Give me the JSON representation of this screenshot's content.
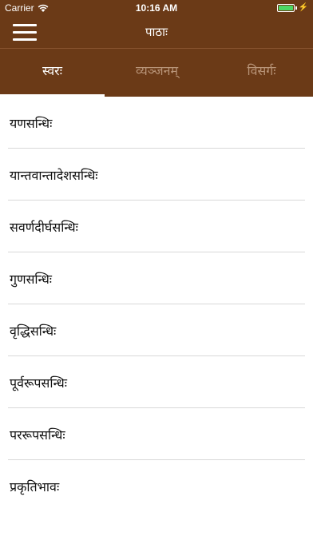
{
  "status_bar": {
    "carrier": "Carrier",
    "time": "10:16 AM",
    "battery_icon": "battery-full-icon",
    "wifi_icon": "wifi-icon",
    "charging_icon": "charging-bolt-icon"
  },
  "nav": {
    "title": "पाठाः",
    "menu_icon": "hamburger-menu-icon"
  },
  "tabs": [
    {
      "label": "स्वरः",
      "active": true
    },
    {
      "label": "व्यञ्जनम्",
      "active": false
    },
    {
      "label": "विसर्गः",
      "active": false
    }
  ],
  "list": {
    "items": [
      {
        "label": "यणसन्धिः"
      },
      {
        "label": "यान्तवान्तादेशसन्धिः"
      },
      {
        "label": "सवर्णदीर्घसन्धिः"
      },
      {
        "label": "गुणसन्धिः"
      },
      {
        "label": "वृद्धिसन्धिः"
      },
      {
        "label": "पूर्वरूपसन्धिः"
      },
      {
        "label": "पररूपसन्धिः"
      },
      {
        "label": "प्रकृतिभावः"
      }
    ]
  },
  "colors": {
    "header_brown": "#6b3a17",
    "tab_inactive": "#b89478",
    "battery_green": "#4cd964"
  }
}
